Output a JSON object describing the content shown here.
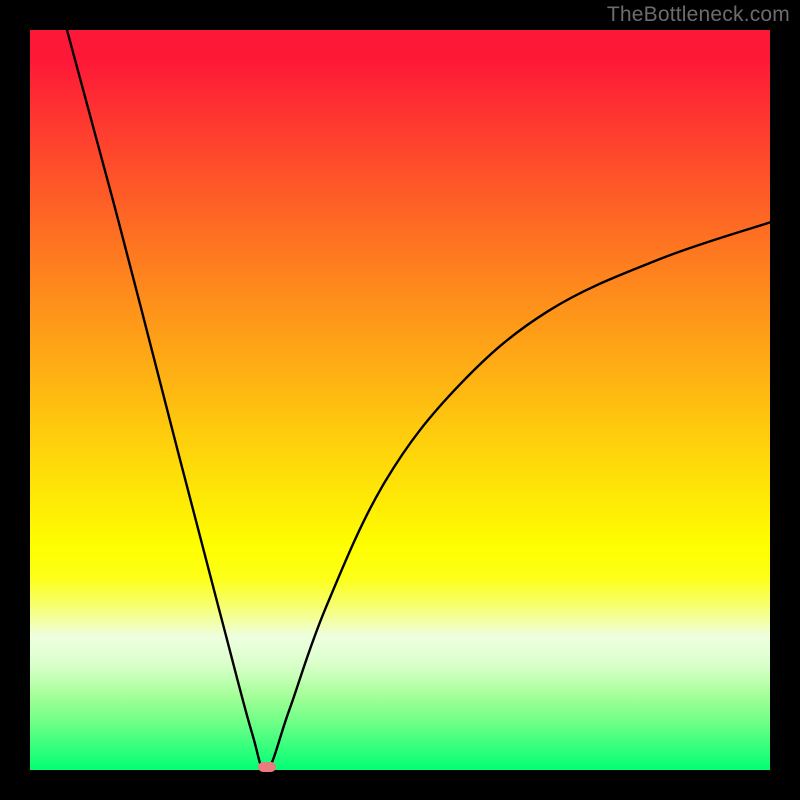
{
  "attribution": "TheBottleneck.com",
  "chart_data": {
    "type": "line",
    "title": "",
    "xlabel": "",
    "ylabel": "",
    "xlim": [
      0,
      100
    ],
    "ylim": [
      0,
      100
    ],
    "curve": {
      "min_x": 32,
      "min_y": 0,
      "left_start": {
        "x": 5,
        "y": 100
      },
      "right_end": {
        "x": 100,
        "y": 74
      },
      "points_left": [
        {
          "x": 5,
          "y": 100
        },
        {
          "x": 12,
          "y": 74
        },
        {
          "x": 20,
          "y": 43
        },
        {
          "x": 26,
          "y": 20
        },
        {
          "x": 30,
          "y": 5
        },
        {
          "x": 32,
          "y": 0
        }
      ],
      "points_right": [
        {
          "x": 32,
          "y": 0
        },
        {
          "x": 35,
          "y": 8
        },
        {
          "x": 40,
          "y": 22
        },
        {
          "x": 48,
          "y": 39
        },
        {
          "x": 58,
          "y": 52
        },
        {
          "x": 70,
          "y": 62
        },
        {
          "x": 85,
          "y": 69
        },
        {
          "x": 100,
          "y": 74
        }
      ]
    },
    "marker": {
      "x": 32,
      "y": 0
    },
    "background_gradient": {
      "top": "#fe1837",
      "mid": "#feff00",
      "bottom": "#01ff74"
    }
  }
}
